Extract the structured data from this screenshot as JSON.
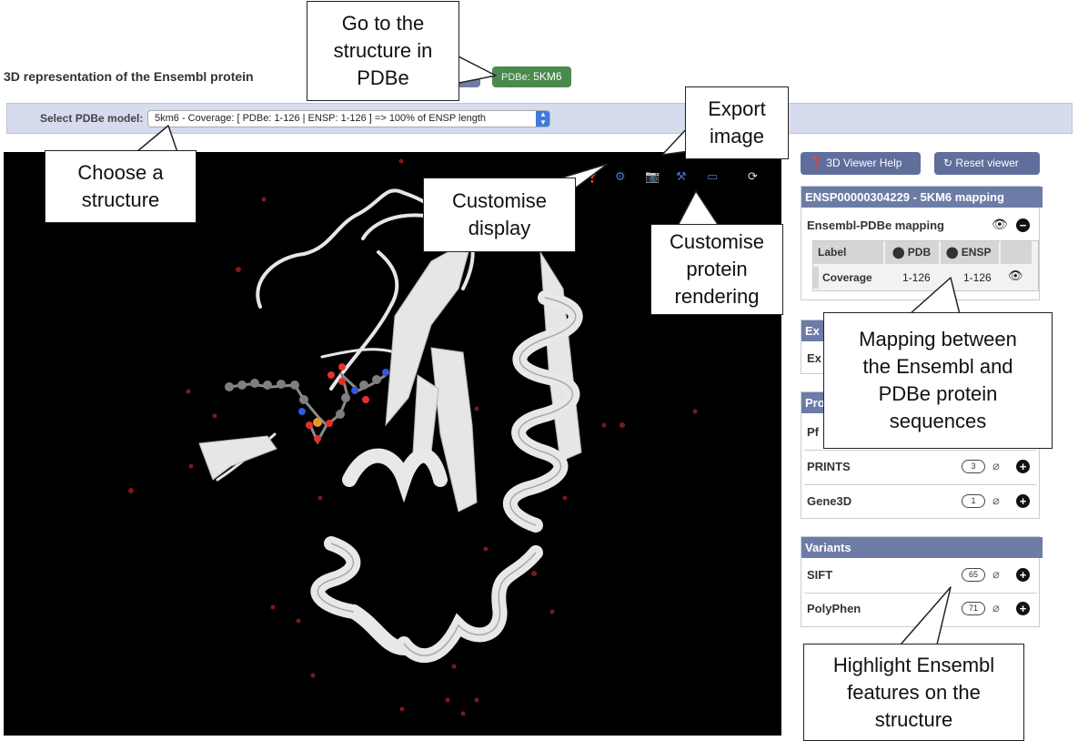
{
  "header": {
    "title": "3D representation of the Ensembl protein",
    "pdbe_badge_prefix": "PDBe:",
    "pdbe_badge_id": "5KM6"
  },
  "model_bar": {
    "label": "Select PDBe model:",
    "selected_value": "5km6 - Coverage: [ PDBe: 1-126 | ENSP: 1-126 ] => 100% of ENSP length"
  },
  "viewer": {
    "toolbar": [
      "help-icon",
      "settings-gear-icon",
      "camera-icon",
      "tools-icon",
      "fullscreen-icon",
      "rotate-icon"
    ],
    "colors": {
      "background": "#000000",
      "ribbon": "#e6e6e6",
      "water": "#7a1a1a",
      "carbon": "#7f7f7f",
      "oxygen": "#e0322b",
      "nitrogen": "#2f59d6",
      "phosphorus": "#e09b2a"
    }
  },
  "sidebar": {
    "help_button": "3D Viewer Help",
    "reset_button": "Reset viewer",
    "mapping_header": "ENSP00000304229 - 5KM6 mapping",
    "mapping_section_label": "Ensembl-PDBe mapping",
    "table": {
      "headers": [
        "Label",
        "PDB",
        "ENSP"
      ],
      "rows": [
        {
          "label": "Coverage",
          "pdb": "1-126",
          "ensp": "1-126"
        }
      ]
    },
    "exon_header_fragment": "Ex",
    "exon_row_fragment": "Ex",
    "protein_header_fragment": "Pro",
    "pfam_fragment": "Pf",
    "protein_features": [
      {
        "label": "PRINTS",
        "count": "3"
      },
      {
        "label": "Gene3D",
        "count": "1"
      }
    ],
    "variants_header": "Variants",
    "variants": [
      {
        "label": "SIFT",
        "count": "65"
      },
      {
        "label": "PolyPhen",
        "count": "71"
      }
    ]
  },
  "callouts": {
    "go_to_structure": "Go to the\nstructure in\nPDBe",
    "choose_structure": "Choose a\nstructure",
    "customise_display": "Customise\ndisplay",
    "export_image": "Export\nimage",
    "customise_rendering": "Customise\nprotein\nrendering",
    "mapping": "Mapping between\nthe Ensembl and\nPDBe protein\nsequences",
    "highlight": "Highlight Ensembl\nfeatures on the\nstructure"
  },
  "colors": {
    "accent": "#5f6e9b",
    "badge_green": "#4a8a4d",
    "select_blue": "#3e7ae0",
    "bar_bg": "#d6dbee"
  }
}
